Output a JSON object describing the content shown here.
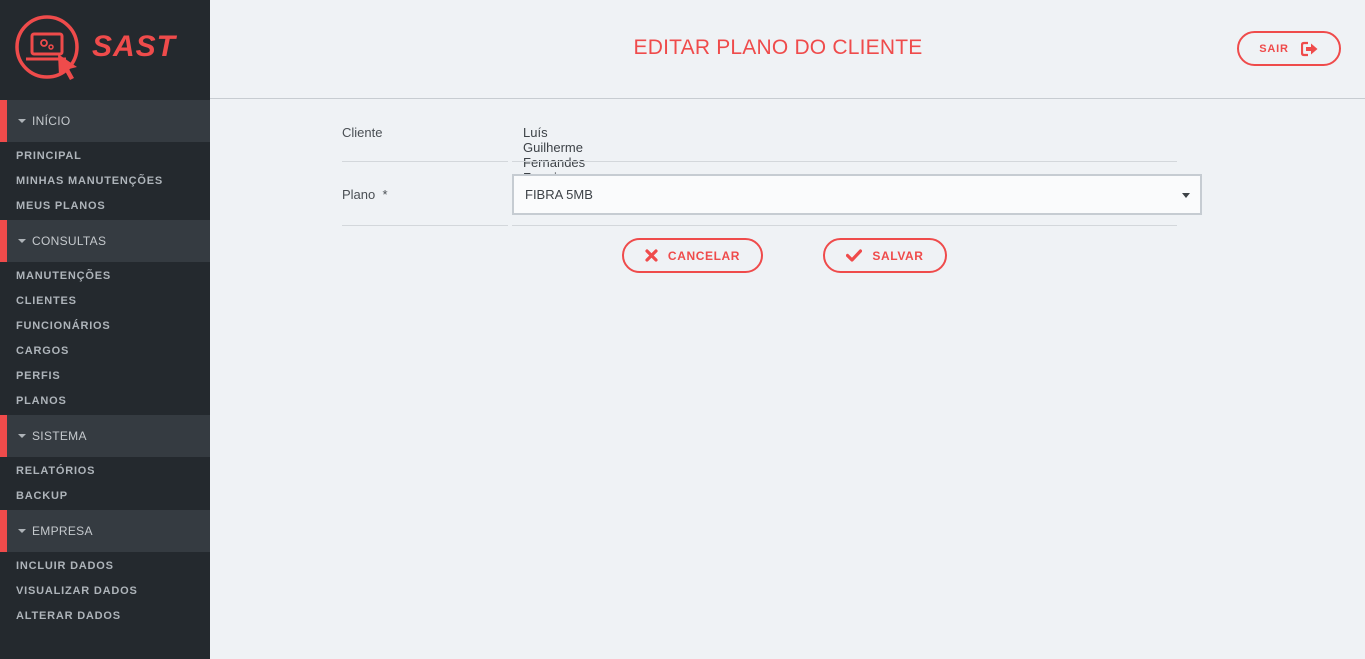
{
  "brand": {
    "name": "SAST"
  },
  "colors": {
    "accent": "#ef4b4b",
    "sidebar": "#24292e",
    "section": "#353b41",
    "background": "#eff2f5"
  },
  "sidebar": {
    "sections": [
      {
        "title": "INÍCIO",
        "items": [
          "PRINCIPAL",
          "MINHAS MANUTENÇÕES",
          "MEUS PLANOS"
        ]
      },
      {
        "title": "CONSULTAS",
        "items": [
          "MANUTENÇÕES",
          "CLIENTES",
          "FUNCIONÁRIOS",
          "CARGOS",
          "PERFIS",
          "PLANOS"
        ]
      },
      {
        "title": "SISTEMA",
        "items": [
          "RELATÓRIOS",
          "BACKUP"
        ]
      },
      {
        "title": "EMPRESA",
        "items": [
          "INCLUIR DADOS",
          "VISUALIZAR DADOS",
          "ALTERAR DADOS"
        ]
      }
    ]
  },
  "header": {
    "title": "EDITAR PLANO DO CLIENTE",
    "logout_label": "SAIR"
  },
  "form": {
    "client_label": "Cliente",
    "client_value": "Luís Guilherme Fernandes Ferreira",
    "plan_label": "Plano  *",
    "plan_selected": "FIBRA 5MB",
    "cancel_label": "CANCELAR",
    "save_label": "SALVAR"
  },
  "icons": {
    "logo": "laptop-cursor-icon",
    "logout": "sign-out-icon",
    "cancel": "x-icon",
    "save": "check-icon",
    "section": "caret-down-icon",
    "select": "dropdown-caret-icon"
  }
}
